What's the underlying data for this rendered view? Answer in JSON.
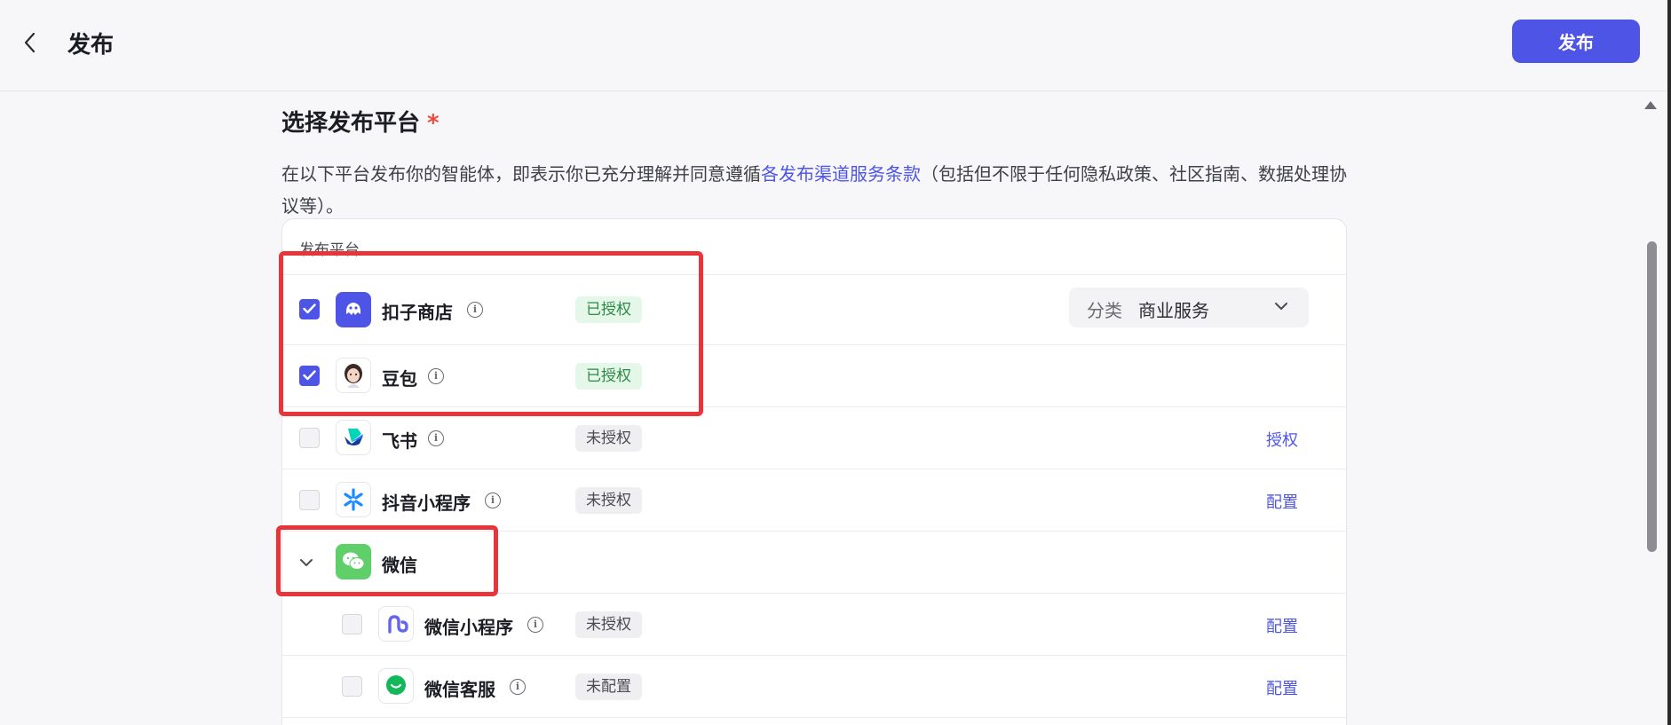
{
  "header": {
    "title": "发布",
    "publish_label": "发布"
  },
  "section": {
    "title": "选择发布平台",
    "required_mark": "*",
    "desc_before": "在以下平台发布你的智能体，即表示你已充分理解并同意遵循",
    "desc_link": "各发布渠道服务条款",
    "desc_after": "（包括但不限于任何隐私政策、社区指南、数据处理协议等）。"
  },
  "table": {
    "header": "发布平台",
    "rows": [
      {
        "name": "扣子商店",
        "status": "已授权",
        "checked": true,
        "icon": "coze-store-icon"
      },
      {
        "name": "豆包",
        "status": "已授权",
        "checked": true,
        "icon": "doubao-icon"
      },
      {
        "name": "飞书",
        "status": "未授权",
        "checked": false,
        "action": "授权",
        "icon": "feishu-icon"
      },
      {
        "name": "抖音小程序",
        "status": "未授权",
        "checked": false,
        "action": "配置",
        "icon": "douyin-miniapp-icon"
      },
      {
        "name": "微信",
        "icon": "wechat-icon",
        "expanded": true
      },
      {
        "name": "微信小程序",
        "status": "未授权",
        "checked": false,
        "action": "配置",
        "icon": "wechat-miniapp-icon"
      },
      {
        "name": "微信客服",
        "status": "未配置",
        "checked": false,
        "action": "配置",
        "icon": "wechat-service-icon"
      }
    ],
    "category": {
      "label": "分类",
      "value": "商业服务"
    }
  },
  "colors": {
    "accent": "#4e55e6",
    "highlight": "#e8353a",
    "authorized_bg": "#e4f7e8",
    "authorized_text": "#2d8a45"
  }
}
